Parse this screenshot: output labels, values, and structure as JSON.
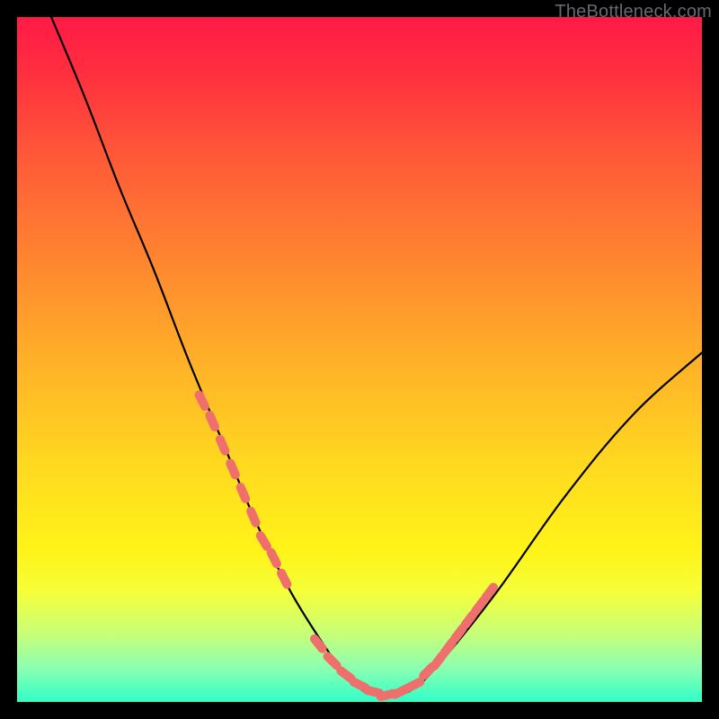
{
  "watermark": "TheBottleneck.com",
  "chart_data": {
    "type": "line",
    "title": "",
    "xlabel": "",
    "ylabel": "",
    "xlim": [
      0,
      100
    ],
    "ylim": [
      0,
      100
    ],
    "gradient_stops": [
      {
        "p": 0,
        "c": "#ff1a46"
      },
      {
        "p": 8,
        "c": "#ff2e3f"
      },
      {
        "p": 20,
        "c": "#ff5838"
      },
      {
        "p": 35,
        "c": "#ff8430"
      },
      {
        "p": 50,
        "c": "#ffb028"
      },
      {
        "p": 65,
        "c": "#ffd820"
      },
      {
        "p": 78,
        "c": "#fff418"
      },
      {
        "p": 84,
        "c": "#f4ff3a"
      },
      {
        "p": 90,
        "c": "#c8ff78"
      },
      {
        "p": 95,
        "c": "#8cffb0"
      },
      {
        "p": 100,
        "c": "#30ffc8"
      }
    ],
    "series": [
      {
        "name": "bottleneck-curve",
        "color": "#000000",
        "x": [
          5,
          10,
          15,
          20,
          25,
          30,
          35,
          40,
          45,
          48,
          50,
          52,
          55,
          58,
          62,
          70,
          80,
          90,
          100
        ],
        "y": [
          100,
          88,
          75,
          63,
          50,
          38,
          26,
          16,
          8,
          4,
          2,
          1,
          1,
          2,
          6,
          16,
          30,
          42,
          51
        ]
      }
    ],
    "highlight_segments": [
      {
        "name": "left-band",
        "color": "#ef6f6c",
        "x": [
          27,
          28.5,
          30,
          31.5,
          33,
          34.5,
          36,
          37.5,
          39
        ],
        "y": [
          44,
          41,
          37.5,
          34,
          30.5,
          27,
          23.5,
          21,
          18
        ]
      },
      {
        "name": "valley-band",
        "color": "#ef6f6c",
        "x": [
          44,
          46,
          48,
          50,
          52,
          54,
          56,
          58
        ],
        "y": [
          8.5,
          6,
          4,
          2.5,
          1.5,
          1,
          1.5,
          2.5
        ]
      },
      {
        "name": "right-band",
        "color": "#ef6f6c",
        "x": [
          60,
          61.5,
          63,
          64.5,
          66,
          67.5,
          69
        ],
        "y": [
          4.5,
          6,
          8,
          10,
          12,
          14,
          16
        ]
      }
    ]
  }
}
